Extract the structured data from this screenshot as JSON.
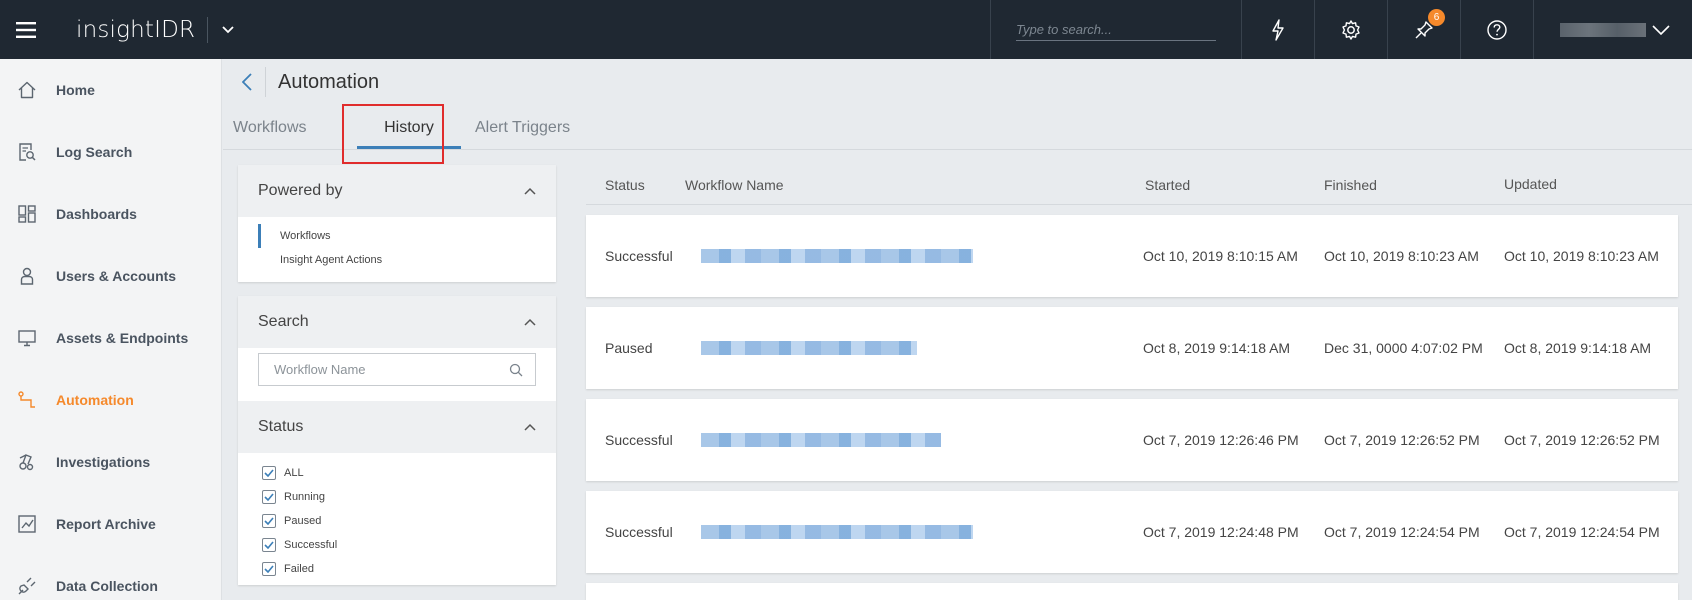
{
  "app": {
    "brand": "insightIDR"
  },
  "topbar": {
    "search_placeholder": "Type to search...",
    "notification_count": "6"
  },
  "sidebar": {
    "items": [
      {
        "label": "Home",
        "icon": "home-icon"
      },
      {
        "label": "Log Search",
        "icon": "log-search-icon"
      },
      {
        "label": "Dashboards",
        "icon": "dashboards-icon"
      },
      {
        "label": "Users & Accounts",
        "icon": "user-icon"
      },
      {
        "label": "Assets & Endpoints",
        "icon": "monitor-icon"
      },
      {
        "label": "Automation",
        "icon": "automation-icon",
        "active": true
      },
      {
        "label": "Investigations",
        "icon": "investigations-icon"
      },
      {
        "label": "Report Archive",
        "icon": "report-icon"
      },
      {
        "label": "Data Collection",
        "icon": "plug-icon"
      }
    ],
    "active_color": "#f5892b"
  },
  "page": {
    "title": "Automation",
    "tabs": [
      {
        "label": "Workflows"
      },
      {
        "label": "History",
        "active": true
      },
      {
        "label": "Alert Triggers"
      }
    ]
  },
  "filters": {
    "powered_by": {
      "title": "Powered by",
      "items": [
        "Workflows",
        "Insight Agent Actions"
      ]
    },
    "search": {
      "title": "Search",
      "placeholder": "Workflow Name"
    },
    "status": {
      "title": "Status",
      "options": [
        "ALL",
        "Running",
        "Paused",
        "Successful",
        "Failed"
      ]
    }
  },
  "table": {
    "columns": [
      "Status",
      "Workflow Name",
      "Started",
      "Finished",
      "Updated"
    ],
    "rows": [
      {
        "status": "Successful",
        "started": "Oct 10, 2019 8:10:15 AM",
        "finished": "Oct 10, 2019 8:10:23 AM",
        "updated": "Oct 10, 2019 8:10:23 AM"
      },
      {
        "status": "Paused",
        "started": "Oct 8, 2019 9:14:18 AM",
        "finished": "Dec 31, 0000 4:07:02 PM",
        "updated": "Oct 8, 2019 9:14:18 AM"
      },
      {
        "status": "Successful",
        "started": "Oct 7, 2019 12:26:46 PM",
        "finished": "Oct 7, 2019 12:26:52 PM",
        "updated": "Oct 7, 2019 12:26:52 PM"
      },
      {
        "status": "Successful",
        "started": "Oct 7, 2019 12:24:48 PM",
        "finished": "Oct 7, 2019 12:24:54 PM",
        "updated": "Oct 7, 2019 12:24:54 PM"
      }
    ]
  },
  "colors": {
    "topbar": "#1f2832",
    "accent": "#3c7fb8",
    "highlight": "#e02c2c"
  }
}
